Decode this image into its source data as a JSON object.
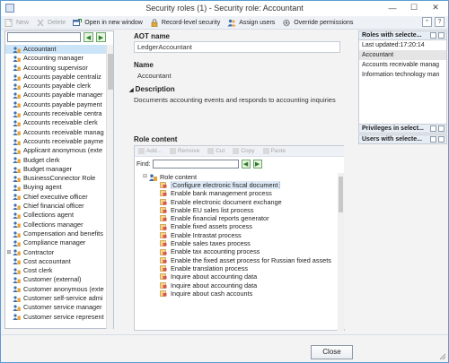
{
  "window": {
    "title": "Security roles (1) - Security role: Accountant",
    "minimize_glyph": "—",
    "maximize_glyph": "☐",
    "close_glyph": "✕"
  },
  "toolbar": {
    "new_label": "New",
    "delete_label": "Delete",
    "open_new_window_label": "Open in new window",
    "record_level_security_label": "Record-level security",
    "assign_users_label": "Assign users",
    "override_permissions_label": "Override permissions"
  },
  "left": {
    "search_value": "",
    "roles": [
      "Accountant",
      "Accounting manager",
      "Accounting supervisor",
      "Accounts payable centraliz",
      "Accounts payable clerk",
      "Accounts payable manager",
      "Accounts payable payment",
      "Accounts receivable centra",
      "Accounts receivable clerk",
      "Accounts receivable manag",
      "Accounts receivable payme",
      "Applicant anonymous (exte",
      "Budget clerk",
      "Budget manager",
      "BusinessConnector Role",
      "Buying agent",
      "Chief executive officer",
      "Chief financial officer",
      "Collections agent",
      "Collections manager",
      "Compensation and benefits",
      "Compliance manager",
      "Contractor",
      "Cost accountant",
      "Cost clerk",
      "Customer (external)",
      "Customer anonymous (exte",
      "Customer self-service admi",
      "Customer service manager",
      "Customer service represent"
    ],
    "selected_index": 0,
    "expandable_index": 22
  },
  "center": {
    "aot_name_label": "AOT name",
    "aot_name_value": "LedgerAccountant",
    "name_label": "Name",
    "name_value": "Accountant",
    "description_label": "Description",
    "description_value": "Documents accounting events and responds to accounting inquiries",
    "role_content_label": "Role content",
    "rc_toolbar": {
      "add_label": "Add...",
      "remove_label": "Remove",
      "cut_label": "Cut",
      "copy_label": "Copy",
      "paste_label": "Paste"
    },
    "find_label": "Find:",
    "find_value": "",
    "tree_root_label": "Role content",
    "tree_items": [
      "Configure electronic fiscal document",
      "Enable bank management process",
      "Enable electronic document exchange",
      "Enable EU sales list process",
      "Enable financial reports generator",
      "Enable fixed assets process",
      "Enable Intrastat process",
      "Enable sales taxes process",
      "Enable tax accounting process",
      "Enable the fixed asset process for Russian fixed assets",
      "Enable translation process",
      "Inquire about accounting data",
      "Inquire about accounting data",
      "Inquire about cash accounts"
    ],
    "selected_tree_index": 0
  },
  "right": {
    "roles_header": "Roles with selecte...",
    "last_updated_label": "Last updated:",
    "last_updated_value": "17:20:14",
    "roles_list": [
      "Accountant",
      "Accounts receivable manag",
      "Information technology man"
    ],
    "privileges_header": "Privileges in select...",
    "users_header": "Users with selecte..."
  },
  "footer": {
    "close_label": "Close"
  },
  "colors": {
    "accent": "#5b9bd5",
    "selection": "#cce4f7",
    "role_icon_orange": "#e8a33a",
    "role_icon_blue": "#3d6fb0"
  }
}
